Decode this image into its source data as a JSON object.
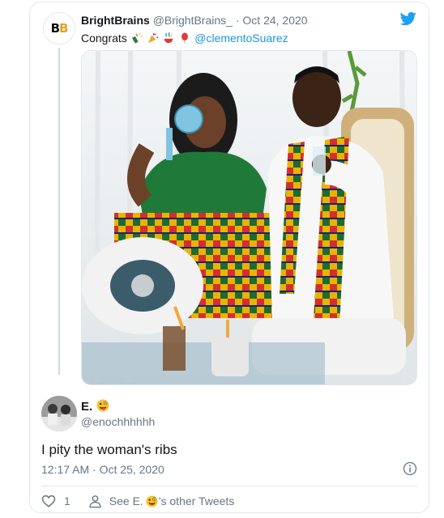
{
  "quoted_tweet": {
    "author_name": "BrightBrains",
    "author_handle": "@BrightBrains_",
    "separator": "·",
    "date": "Oct 24, 2020",
    "text_prefix": "Congrats",
    "emojis": [
      "bottle-with-popping-cork",
      "party-popper",
      "confetti-ball",
      "balloon"
    ],
    "mention": "@clementoSuarez",
    "avatar_logo_text": "BB"
  },
  "reply_tweet": {
    "author_name": "E.",
    "author_emoji": "zany-face",
    "author_handle": "@enochhhhhh",
    "text": "I pity the woman's ribs",
    "time": "12:17 AM",
    "separator": "·",
    "date": "Oct 25, 2020",
    "like_count": "1",
    "see_other_prefix": "See E.",
    "see_other_suffix": "'s other Tweets"
  },
  "colors": {
    "twitter_blue": "#1da1f2",
    "link": "#1b95e0",
    "secondary_text": "#657786",
    "border": "#e1e8ed"
  }
}
